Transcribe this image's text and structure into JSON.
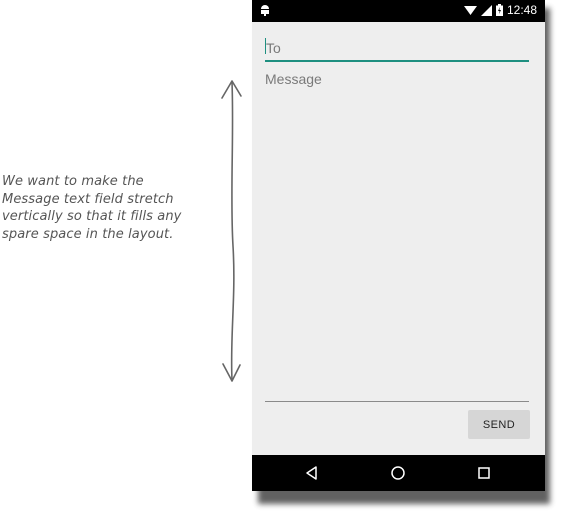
{
  "annotation": {
    "lines": [
      "We want to make the",
      "Message text field stretch",
      "vertically so that it fills any",
      "spare space in the layout."
    ]
  },
  "status_bar": {
    "left_icon": "android-debug-icon",
    "icons": [
      "wifi-icon",
      "signal-icon",
      "battery-icon"
    ],
    "time": "12:48"
  },
  "form": {
    "to_placeholder": "To",
    "message_placeholder": "Message",
    "send_label": "SEND"
  },
  "nav_bar": {
    "icons": [
      "back-icon",
      "home-icon",
      "recents-icon"
    ]
  },
  "colors": {
    "accent": "#1e8f80",
    "screen_background": "#eeeeee",
    "button_background": "#d6d6d6"
  }
}
